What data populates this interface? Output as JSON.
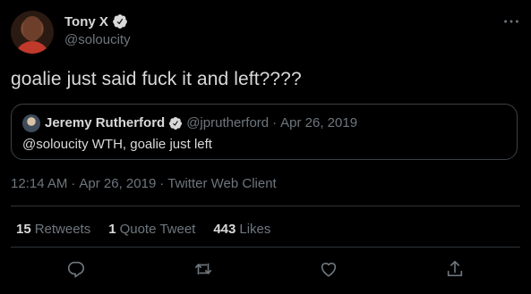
{
  "tweet": {
    "author": {
      "display_name": "Tony X",
      "handle": "@soloucity",
      "verified": true
    },
    "text": "goalie just said fuck it and left????",
    "quoted": {
      "display_name": "Jeremy Rutherford",
      "handle": "@jprutherford",
      "separator": "·",
      "date": "Apr 26, 2019",
      "text": "@soloucity WTH, goalie just left"
    },
    "time": "12:14 AM",
    "separator": "·",
    "date": "Apr 26, 2019",
    "source": "Twitter Web Client"
  },
  "stats": {
    "retweets_count": "15",
    "retweets_label": "Retweets",
    "quotes_count": "1",
    "quotes_label": "Quote Tweet",
    "likes_count": "443",
    "likes_label": "Likes"
  },
  "actions": [
    "reply-icon",
    "retweet-icon",
    "like-icon",
    "share-icon"
  ],
  "colors": {
    "background": "#000000",
    "text": "#d9d9d9",
    "muted": "#6e767d",
    "verified": "#d9d9d9",
    "divider": "#2f3336"
  }
}
